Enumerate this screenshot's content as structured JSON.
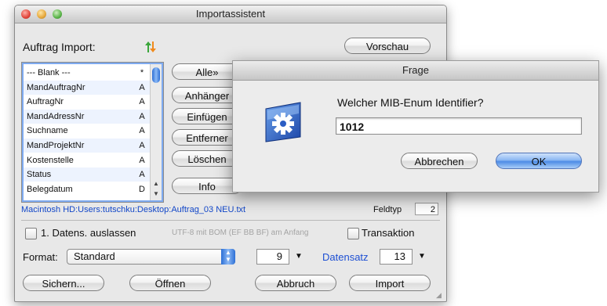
{
  "main_window": {
    "title": "Importassistent",
    "auftrag_label": "Auftrag Import:",
    "preview_button": "Vorschau",
    "fields": [
      {
        "name": "--- Blank ---",
        "type": "*"
      },
      {
        "name": "MandAuftragNr",
        "type": "A"
      },
      {
        "name": "AuftragNr",
        "type": "A"
      },
      {
        "name": "MandAdressNr",
        "type": "A"
      },
      {
        "name": "Suchname",
        "type": "A"
      },
      {
        "name": "MandProjektNr",
        "type": "A"
      },
      {
        "name": "Kostenstelle",
        "type": "A"
      },
      {
        "name": "Status",
        "type": "A"
      },
      {
        "name": "Belegdatum",
        "type": "D"
      }
    ],
    "side_buttons": [
      "Alle»",
      "Anhänger",
      "Einfügen",
      "Entferner",
      "Löschen",
      "Info"
    ],
    "file_path": "Macintosh HD:Users:tutschku:Desktop:Auftrag_03 NEU.txt",
    "feldtyp_label": "Feldtyp",
    "feldtyp_value": "2",
    "skip_first_label": "1. Datens. auslassen",
    "encoding_hint": "UTF-8 mit BOM (EF BB BF) am Anfang",
    "transaction_label": "Transaktion",
    "format_label": "Format:",
    "format_value": "Standard",
    "separator_value": "9",
    "datensatz_label": "Datensatz",
    "datensatz_value": "13",
    "buttons": {
      "save": "Sichern...",
      "open": "Öffnen",
      "cancel": "Abbruch",
      "import": "Import"
    }
  },
  "dialog": {
    "title": "Frage",
    "question": "Welcher MIB-Enum Identifier?",
    "input_value": "1012",
    "cancel_button": "Abbrechen",
    "ok_button": "OK"
  },
  "colors": {
    "accent": "#2c6fd6",
    "link": "#1247c8"
  }
}
